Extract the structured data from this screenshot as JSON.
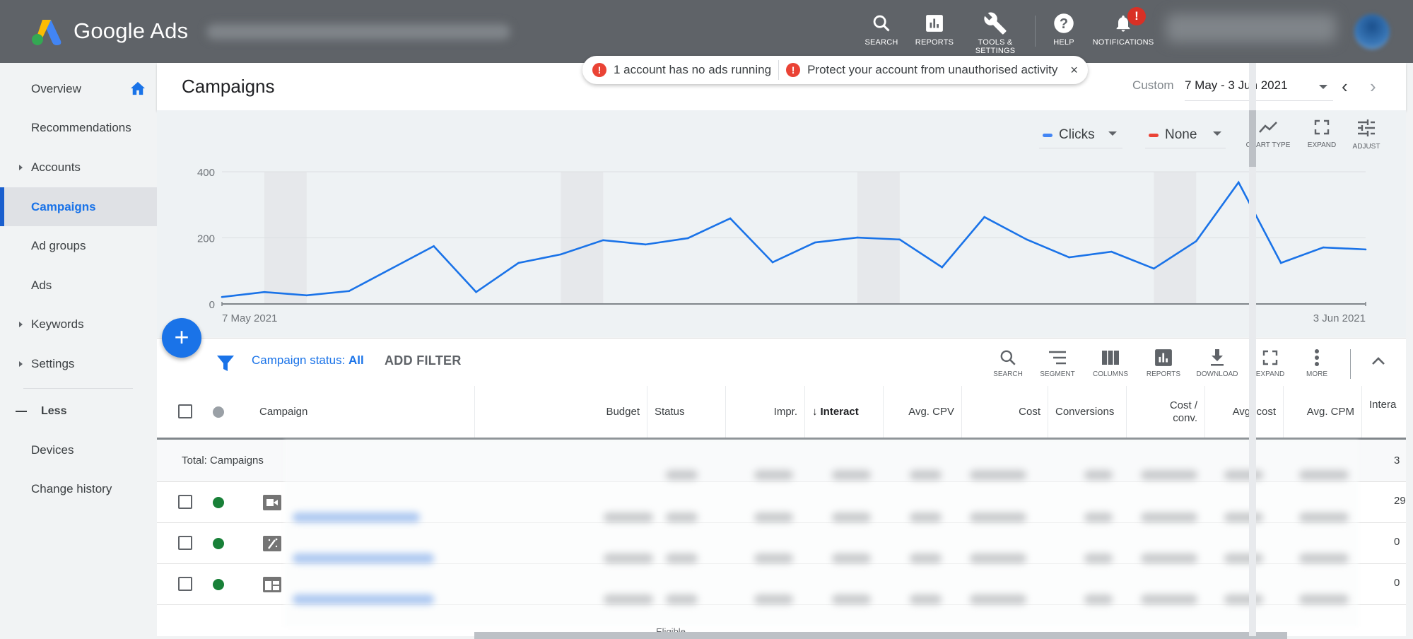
{
  "app": {
    "brand": "Google Ads",
    "account_name_blurred": true
  },
  "topnav": [
    {
      "label": "SEARCH",
      "icon": "search-icon"
    },
    {
      "label": "REPORTS",
      "icon": "reports-icon"
    },
    {
      "label": "TOOLS & SETTINGS",
      "icon": "wrench-icon"
    },
    {
      "label": "HELP",
      "icon": "help-icon"
    },
    {
      "label": "NOTIFICATIONS",
      "icon": "bell-icon",
      "badge": "!"
    }
  ],
  "alerts": {
    "items": [
      {
        "icon": "!",
        "text": "1 account has no ads running"
      },
      {
        "icon": "!",
        "text": "Protect your account from unauthorised activity"
      }
    ],
    "close": "×"
  },
  "sidebar": {
    "items": [
      {
        "label": "Overview",
        "icon": "home-icon"
      },
      {
        "label": "Recommendations"
      },
      {
        "label": "Accounts",
        "expandable": true
      },
      {
        "label": "Campaigns",
        "active": true
      },
      {
        "label": "Ad groups"
      },
      {
        "label": "Ads"
      },
      {
        "label": "Keywords",
        "expandable": true
      },
      {
        "label": "Settings",
        "expandable": true
      }
    ],
    "less_label": "Less",
    "extra_items": [
      {
        "label": "Devices"
      },
      {
        "label": "Change history"
      }
    ]
  },
  "header": {
    "title": "Campaigns",
    "date_range_label": "Custom",
    "date_range_value": "7 May - 3 Jun 2021",
    "prev": "‹",
    "next": "›"
  },
  "chart_controls": {
    "metric1": {
      "label": "Clicks",
      "color": "#4285f4"
    },
    "metric2": {
      "label": "None",
      "color": "#ea4335"
    },
    "tools": [
      {
        "label": "CHART TYPE",
        "icon": "line-chart-icon"
      },
      {
        "label": "EXPAND",
        "icon": "expand-icon"
      },
      {
        "label": "ADJUST",
        "icon": "adjust-icon"
      }
    ]
  },
  "chart_data": {
    "type": "line",
    "title": "",
    "xlabel": "",
    "ylabel": "Clicks",
    "x_start_label": "7 May 2021",
    "x_end_label": "3 Jun 2021",
    "x": [
      "7 May",
      "8 May",
      "9 May",
      "10 May",
      "11 May",
      "12 May",
      "13 May",
      "14 May",
      "15 May",
      "16 May",
      "17 May",
      "18 May",
      "19 May",
      "20 May",
      "21 May",
      "22 May",
      "23 May",
      "24 May",
      "25 May",
      "26 May",
      "27 May",
      "28 May",
      "29 May",
      "30 May",
      "31 May",
      "1 Jun",
      "2 Jun",
      "3 Jun"
    ],
    "series": [
      {
        "name": "Clicks",
        "color": "#1a73e8",
        "values": [
          21,
          36,
          26,
          39,
          107,
          175,
          36,
          124,
          150,
          193,
          180,
          199,
          259,
          126,
          186,
          201,
          195,
          111,
          263,
          195,
          141,
          158,
          107,
          190,
          368,
          124,
          171,
          165
        ]
      }
    ],
    "yticks": [
      0,
      200,
      400
    ],
    "ylim": [
      0,
      400
    ],
    "grid": true,
    "weekend_bands": [
      [
        "8 May",
        "9 May"
      ],
      [
        "15 May",
        "16 May"
      ],
      [
        "22 May",
        "23 May"
      ],
      [
        "29 May",
        "30 May"
      ]
    ]
  },
  "fab": {
    "label": "+"
  },
  "filter_bar": {
    "filter_prefix": "Campaign status: ",
    "filter_value": "All",
    "add_filter": "ADD FILTER",
    "tools": [
      {
        "label": "SEARCH",
        "icon": "search-icon"
      },
      {
        "label": "SEGMENT",
        "icon": "segment-icon"
      },
      {
        "label": "COLUMNS",
        "icon": "columns-icon"
      },
      {
        "label": "REPORTS",
        "icon": "reports-icon"
      },
      {
        "label": "DOWNLOAD",
        "icon": "download-icon"
      },
      {
        "label": "EXPAND",
        "icon": "expand-icon"
      },
      {
        "label": "MORE",
        "icon": "more-vert-icon"
      }
    ]
  },
  "table": {
    "columns": [
      "Campaign",
      "Budget",
      "Status",
      "Impr.",
      "Interact",
      "Avg. CPV",
      "Cost",
      "Conversions",
      "Cost / conv.",
      "Avg. cost",
      "Avg. CPM",
      "Intera"
    ],
    "sorted_column": "Interact",
    "total_label": "Total: Campaigns",
    "rows": [
      {
        "type_icon": "video-campaign-icon",
        "status_color": "#188038",
        "last_col": "29"
      },
      {
        "type_icon": "smart-campaign-icon",
        "status_color": "#188038",
        "last_col": "0"
      },
      {
        "type_icon": "display-campaign-icon",
        "status_color": "#188038",
        "last_col": "0"
      }
    ],
    "total_last_col": "3",
    "partial_status_text": "Eligible"
  }
}
